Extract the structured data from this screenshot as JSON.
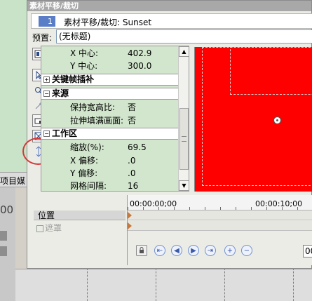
{
  "background": {
    "left_tab_label": "项目媒体",
    "left_timecode": "00"
  },
  "dialog": {
    "title": "素材平移/裁切",
    "header_number": "1",
    "header_title": "素材平移/裁切: Sunset",
    "preset_label": "预置:",
    "preset_value": "(无标题)"
  },
  "properties": {
    "rows_top": [
      {
        "label": "X 中心:",
        "value": "402.9"
      },
      {
        "label": "Y 中心:",
        "value": "300.0"
      }
    ],
    "sections": {
      "keyframe": "关键帧插补",
      "source": "来源",
      "workspace": "工作区"
    },
    "rows_source": [
      {
        "label": "保持宽高比:",
        "value": "否"
      },
      {
        "label": "拉伸填满画面:",
        "value": "否"
      }
    ],
    "rows_workspace": [
      {
        "label": "缩放(%):",
        "value": "69.5"
      },
      {
        "label": "X 偏移:",
        "value": ".0"
      },
      {
        "label": "Y 偏移:",
        "value": ".0"
      },
      {
        "label": "网格间隔:",
        "value": "16"
      }
    ]
  },
  "timeline": {
    "track_label": "位置",
    "sub_label": "遮罩",
    "time_start": "00:00:00;00",
    "time_mid": "00:00:10;00",
    "frame_box": "00"
  },
  "colors": {
    "preview_fill": "#ff0000",
    "annotation_circle": "#d43a3a",
    "panel_green": "#d2e6cd"
  }
}
